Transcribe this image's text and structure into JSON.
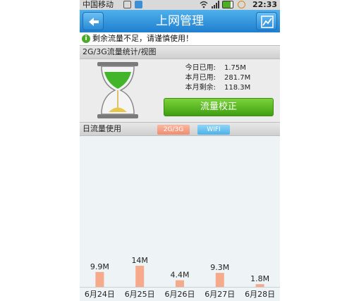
{
  "status_bar": {
    "carrier": "中国移动",
    "time": "22:33"
  },
  "title_bar": {
    "title": "上网管理",
    "back_icon": "back-arrow-icon",
    "chart_icon": "trend-chart-icon"
  },
  "warning": {
    "icon": "info-icon",
    "text": "剩余流量不足，请谨慎使用！"
  },
  "stats_section": {
    "header": "2G/3G流量统计/视图",
    "rows": [
      {
        "label": "今日已用:",
        "value": "1.75M"
      },
      {
        "label": "本月已用:",
        "value": "281.7M"
      },
      {
        "label": "本月剩余:",
        "value": "118.3M"
      }
    ],
    "calibrate_button": "流量校正"
  },
  "daily_section": {
    "header": "日流量使用",
    "tabs": [
      "2G/3G",
      "WIFI"
    ],
    "active_tab": "2G/3G"
  },
  "chart_data": {
    "type": "bar",
    "categories": [
      "6月24日",
      "6月25日",
      "6月26日",
      "6月27日",
      "6月28日"
    ],
    "values": [
      9.9,
      14,
      4.4,
      9.3,
      1.8
    ],
    "data_labels": [
      "9.9M",
      "14M",
      "4.4M",
      "9.3M",
      "1.8M"
    ],
    "bar_color": "#f7a98c",
    "ylim": [
      0,
      100
    ]
  }
}
